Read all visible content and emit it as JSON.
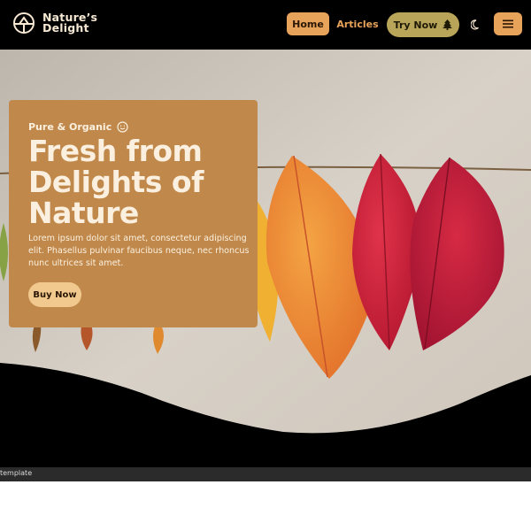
{
  "brand": {
    "line1": "Nature’s",
    "line2": "Delight",
    "logo_icon": "leaf-logo-icon"
  },
  "nav": {
    "home": "Home",
    "articles": "Articles",
    "try_now": "Try Now",
    "try_icon": "tree-icon",
    "theme_icon": "moon-icon",
    "menu_icon": "hamburger-menu-icon"
  },
  "hero": {
    "eyebrow": "Pure & Organic",
    "eyebrow_icon": "smile-icon",
    "headline": [
      "Fresh from",
      "Delights of",
      "Nature"
    ],
    "body": "Lorem ipsum dolor sit amet, consectetur adipiscing elit. Phasellus pulvinar faucibus neque, nec rhoncus nunc ultrices sit amet.",
    "cta": "Buy Now"
  },
  "statusbar": {
    "text": "template"
  },
  "colors": {
    "accent": "#e8a35a",
    "card": "#c0884a",
    "olive": "#b9a55a",
    "dark": "#000000"
  }
}
